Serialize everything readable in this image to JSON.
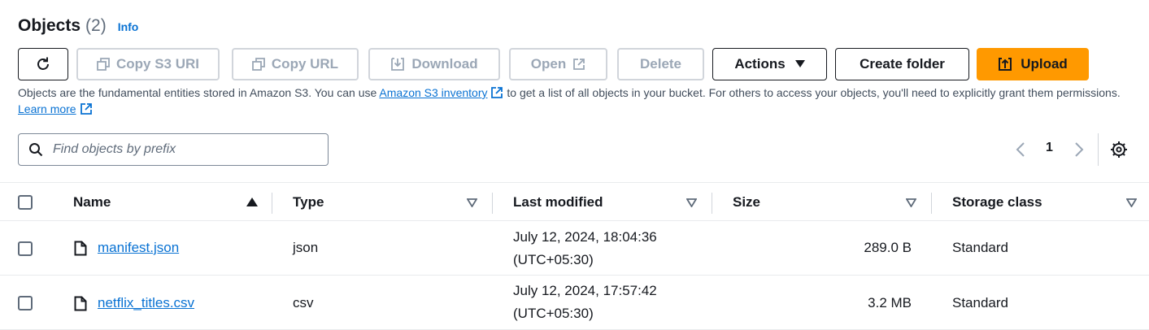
{
  "header": {
    "title": "Objects",
    "count": "(2)",
    "info": "Info"
  },
  "toolbar": {
    "copy_uri": "Copy S3 URI",
    "copy_url": "Copy URL",
    "download": "Download",
    "open": "Open",
    "delete": "Delete",
    "actions": "Actions",
    "create_folder": "Create folder",
    "upload": "Upload"
  },
  "description": {
    "part1": "Objects are the fundamental entities stored in Amazon S3. You can use ",
    "inventory_link": "Amazon S3 inventory",
    "part2": " to get a list of all objects in your bucket. For others to access your objects, you'll need to explicitly grant them permissions. ",
    "learn_more": "Learn more"
  },
  "search": {
    "placeholder": "Find objects by prefix"
  },
  "pagination": {
    "current_page": "1"
  },
  "table": {
    "columns": {
      "name": "Name",
      "type": "Type",
      "last_modified": "Last modified",
      "size": "Size",
      "storage_class": "Storage class"
    },
    "rows": [
      {
        "name": "manifest.json",
        "type": "json",
        "modified_date": "July 12, 2024, 18:04:36",
        "modified_tz": "(UTC+05:30)",
        "size": "289.0 B",
        "storage_class": "Standard"
      },
      {
        "name": "netflix_titles.csv",
        "type": "csv",
        "modified_date": "July 12, 2024, 17:57:42",
        "modified_tz": "(UTC+05:30)",
        "size": "3.2 MB",
        "storage_class": "Standard"
      }
    ]
  },
  "colors": {
    "accent": "#ff9900",
    "link": "#0972d3",
    "text": "#16191f",
    "disabled": "#9ba7b6"
  },
  "icons": {
    "refresh": "refresh-icon",
    "copy": "copy-icon",
    "download": "download-icon",
    "external": "external-link-icon",
    "caret": "caret-down-icon",
    "upload": "upload-icon",
    "search": "search-icon",
    "file": "file-icon",
    "gear": "gear-icon"
  }
}
